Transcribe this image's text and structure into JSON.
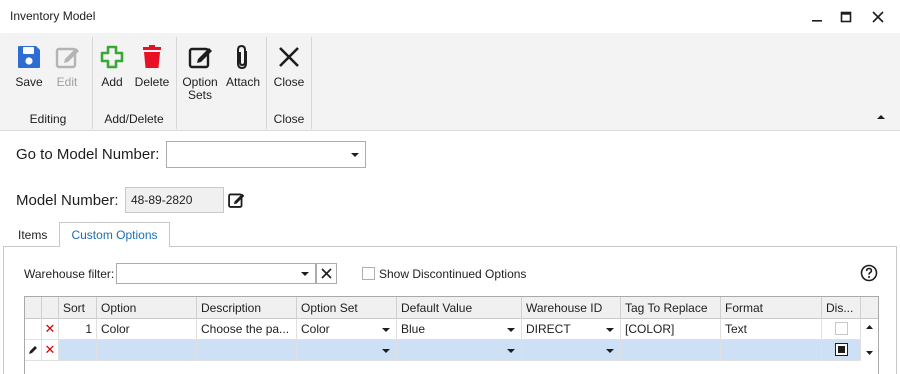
{
  "window": {
    "title": "Inventory Model"
  },
  "ribbon": {
    "groups": [
      {
        "label": "Editing",
        "buttons": [
          {
            "label": "Save"
          },
          {
            "label": "Edit"
          }
        ]
      },
      {
        "label": "Add/Delete",
        "buttons": [
          {
            "label": "Add"
          },
          {
            "label": "Delete"
          }
        ]
      },
      {
        "label": "",
        "buttons": [
          {
            "label": "Option\nSets"
          },
          {
            "label": "Attach"
          }
        ]
      },
      {
        "label": "Close",
        "buttons": [
          {
            "label": "Close"
          }
        ]
      }
    ],
    "option_sets_line1": "Option",
    "option_sets_line2": "Sets"
  },
  "form": {
    "goto_label": "Go to Model Number:",
    "goto_value": "",
    "model_label": "Model Number:",
    "model_value": "48-89-2820"
  },
  "tabs": [
    {
      "label": "Items",
      "active": false
    },
    {
      "label": "Custom Options",
      "active": true
    }
  ],
  "filter": {
    "warehouse_label": "Warehouse filter:",
    "warehouse_value": "",
    "show_discontinued_label": "Show Discontinued Options",
    "show_discontinued_checked": false
  },
  "grid": {
    "columns": [
      "Sort",
      "Option",
      "Description",
      "Option Set",
      "Default Value",
      "Warehouse ID",
      "Tag To Replace",
      "Format",
      "Dis..."
    ],
    "rows": [
      {
        "sort": "1",
        "option": "Color",
        "description": "Choose the pa...",
        "option_set": "Color",
        "default_value": "Blue",
        "warehouse_id": "DIRECT",
        "tag": "[COLOR]",
        "format": "Text",
        "discontinued": false
      }
    ]
  },
  "colors": {
    "save_blue": "#2d6cd2",
    "add_green": "#39a935",
    "delete_red": "#e81123",
    "tab_active_text": "#1a6fb5",
    "new_row_bg": "#cde0f5"
  },
  "icons": {
    "save": "floppy-disk-icon",
    "edit": "edit-icon",
    "add": "plus-icon",
    "delete": "trash-icon",
    "option_sets": "pencil-box-icon",
    "attach": "paperclip-icon",
    "close": "x-icon",
    "help": "question-circle-icon"
  }
}
